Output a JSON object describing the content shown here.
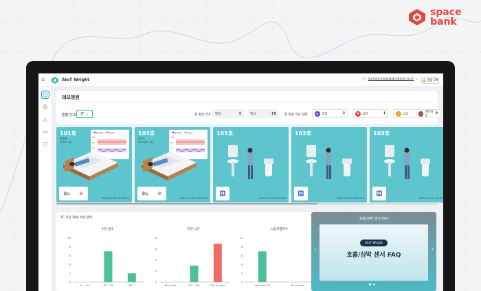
{
  "brand": {
    "line1": "space",
    "line2": "bank",
    "color": "#e8453c"
  },
  "app": {
    "title": "AIoT Wright",
    "user_email": "humancare@spacebank.co.kr",
    "alarm_label": "알림 Off"
  },
  "sidebar": {
    "items": [
      {
        "icon": "home-icon",
        "active": true
      },
      {
        "icon": "users-icon",
        "active": false
      },
      {
        "icon": "alert-icon",
        "active": false
      },
      {
        "icon": "monitor-icon",
        "active": false
      },
      {
        "icon": "document-icon",
        "active": false
      }
    ]
  },
  "hospital": {
    "name": "데모병원",
    "floor_label": "층별 안내",
    "floor_value": "1F",
    "room_info_label": "층 병실 안내",
    "stat1": {
      "label": "병실",
      "value": "3"
    },
    "stat2": {
      "label": "병상",
      "value": "15"
    },
    "alert_label": "층 병실 이상 현황",
    "alerts": [
      {
        "label": "호흡",
        "value": "2",
        "color": "#6a3fb5"
      },
      {
        "label": "심박",
        "value": "1",
        "color": "#e8453c"
      },
      {
        "label": "낙상",
        "value": "1",
        "color": "#f0a020"
      },
      {
        "label": "네트워크",
        "value": "0",
        "color": "#a04040"
      }
    ]
  },
  "rooms": [
    {
      "num": "101호",
      "sub1": "홍길동1",
      "sub2": "(Male, 2S)",
      "time": "2025-07-29 15:28:40",
      "type": "bed",
      "legend_breath": "Breath",
      "legend_heart": "Heart",
      "bpm_top": "120",
      "bpm_mid": "60",
      "bpm_low": "20",
      "bpm_bottom": "10"
    },
    {
      "num": "103호",
      "sub1": "김미소",
      "sub2": "(Female, 38)",
      "time": "2025-07-29 16:21:40",
      "type": "bed",
      "legend_breath": "Breath",
      "legend_heart": "Heart",
      "bpm_top": "120",
      "bpm_mid": "60",
      "bpm_low": "20",
      "bpm_bottom": "10"
    },
    {
      "num": "101호",
      "sub1": "",
      "sub2": "",
      "time": "2025-07-24 16:22:40",
      "type": "standing"
    },
    {
      "num": "102호",
      "sub1": "",
      "sub2": "",
      "time": "2025-07-29 16:11:48",
      "type": "standing"
    },
    {
      "num": "103호",
      "sub1": "",
      "sub2": "",
      "time": "2025-07-29 16:11",
      "type": "standing"
    }
  ],
  "sleep_panel": {
    "title": "1F 지난 30일 수면 상태",
    "charts": [
      {
        "type": "bar",
        "title": "수면 점수",
        "categories": [
          "0 ~ 59",
          "60 ~ 84",
          "84 ~"
        ],
        "values": [
          0,
          7,
          2
        ],
        "ylim": [
          0,
          10
        ],
        "yticks": [
          "10",
          "8",
          "6",
          "4",
          "2",
          "0"
        ],
        "color": "#4cbf9c"
      },
      {
        "type": "bar",
        "title": "수면 시간",
        "categories": [
          "6h or less",
          "6h ~ 10h",
          "10h or more"
        ],
        "values": [
          0,
          3,
          7
        ],
        "ylim": [
          0,
          8
        ],
        "yticks": [
          "8",
          "6",
          "4",
          "2",
          "0"
        ],
        "colors": [
          "#4cbf9c",
          "#4cbf9c",
          "#f06a6a"
        ]
      },
      {
        "type": "bar",
        "title": "낙상위험지수",
        "categories": [
          "Less than 50",
          "50 or more"
        ],
        "values": [
          7,
          0
        ],
        "ylim": [
          0,
          10
        ],
        "yticks": [
          "10",
          "8",
          "6",
          "4",
          "2",
          "0"
        ],
        "color": "#4cbf9c"
      }
    ]
  },
  "faq": {
    "header": "호흡/심박 센서 FAQ",
    "badge": "AIoT Wright",
    "title": "호흡/심박 센서 FAQ",
    "prev": "‹",
    "next": "›"
  }
}
